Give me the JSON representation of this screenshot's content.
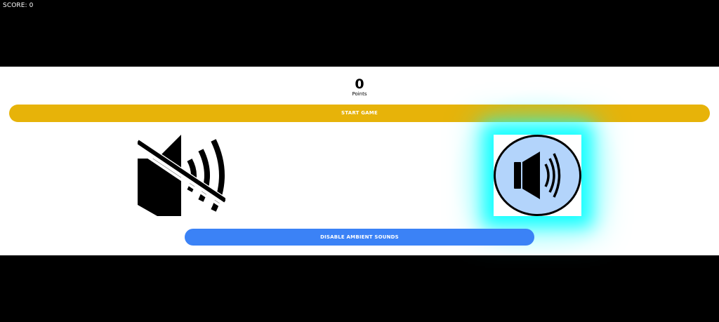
{
  "hud": {
    "score_text": "SCORE: 0"
  },
  "scoreboard": {
    "value": "0",
    "label": "Points"
  },
  "controls": {
    "start_label": "START GAME",
    "ambient_label": "DISABLE AMBIENT SOUNDS"
  },
  "sound_options": [
    {
      "icon": "speaker-muted-icon",
      "selected": false
    },
    {
      "icon": "speaker-on-icon",
      "selected": true
    }
  ],
  "colors": {
    "start_button": "#e7b309",
    "ambient_button": "#3b82f6",
    "selected_glow": "#00ffff",
    "speaker_on_fill": "#b3d4fb"
  }
}
